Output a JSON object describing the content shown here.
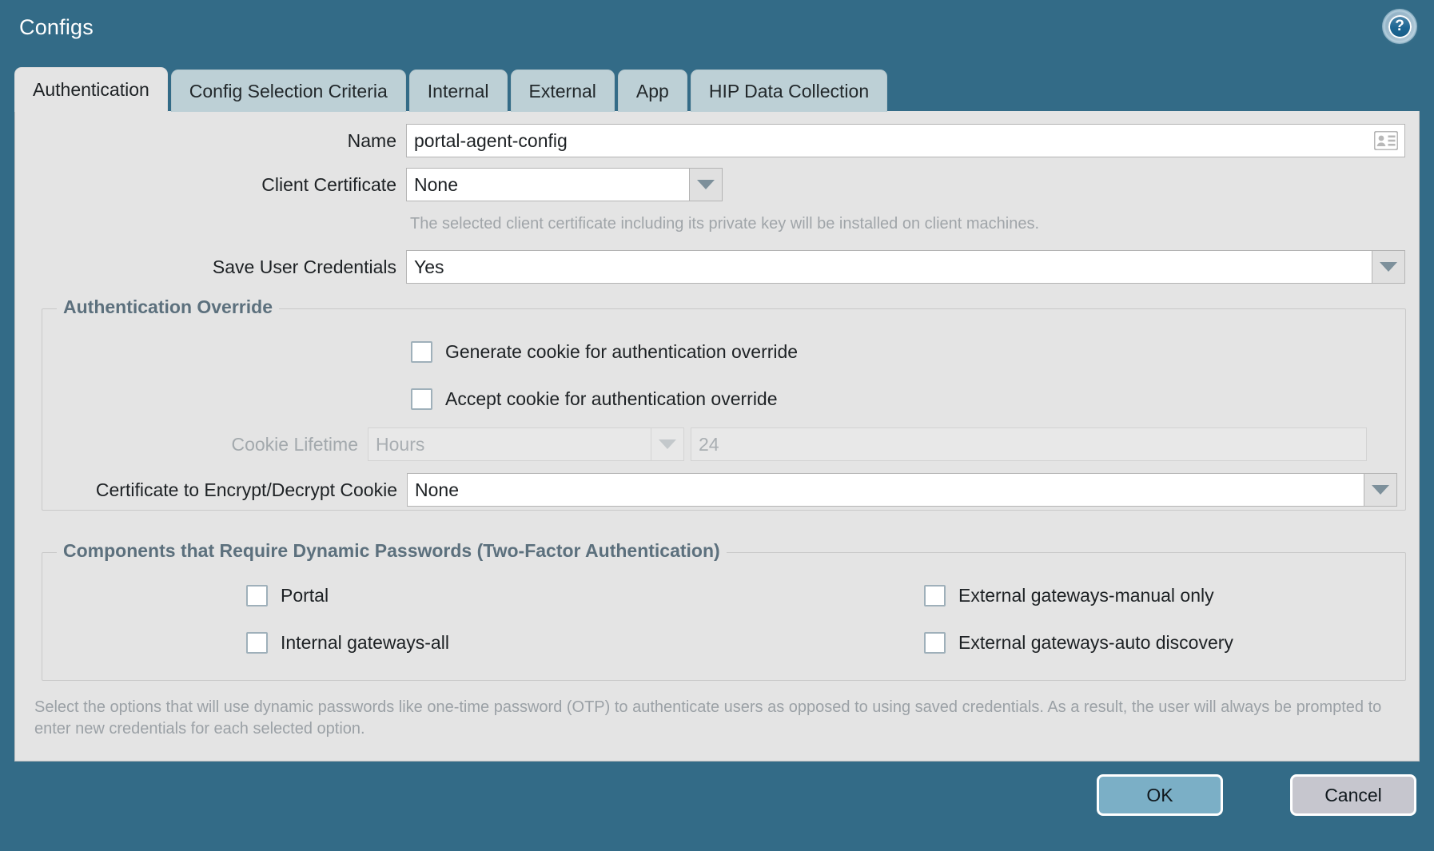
{
  "window": {
    "title": "Configs",
    "help_icon": "help-question-icon",
    "accent_color": "#336b87",
    "panel_bg": "#e4e4e4"
  },
  "tabs": [
    {
      "label": "Authentication",
      "active": true
    },
    {
      "label": "Config Selection Criteria",
      "active": false
    },
    {
      "label": "Internal",
      "active": false
    },
    {
      "label": "External",
      "active": false
    },
    {
      "label": "App",
      "active": false
    },
    {
      "label": "HIP Data Collection",
      "active": false
    }
  ],
  "form": {
    "name": {
      "label": "Name",
      "value": "portal-agent-config",
      "icon": "id-card-icon"
    },
    "client_certificate": {
      "label": "Client Certificate",
      "value": "None",
      "hint": "The selected client certificate including its private key will be installed on client machines."
    },
    "save_user_credentials": {
      "label": "Save User Credentials",
      "value": "Yes"
    }
  },
  "auth_override": {
    "legend": "Authentication Override",
    "generate_cookie": {
      "label": "Generate cookie for authentication override",
      "checked": false
    },
    "accept_cookie": {
      "label": "Accept cookie for authentication override",
      "checked": false
    },
    "cookie_lifetime": {
      "label": "Cookie Lifetime",
      "unit_value": "Hours",
      "amount_value": "24",
      "disabled": true
    },
    "certificate_cookie": {
      "label": "Certificate to Encrypt/Decrypt Cookie",
      "value": "None"
    }
  },
  "two_factor": {
    "legend": "Components that Require Dynamic Passwords (Two-Factor Authentication)",
    "options": [
      {
        "label": "Portal",
        "checked": false
      },
      {
        "label": "Internal gateways-all",
        "checked": false
      },
      {
        "label": "External gateways-manual only",
        "checked": false
      },
      {
        "label": "External gateways-auto discovery",
        "checked": false
      }
    ],
    "note": "Select the options that will use dynamic passwords like one-time password (OTP) to authenticate users as opposed to using saved credentials. As a result, the user will always be prompted to enter new credentials for each selected option."
  },
  "footer": {
    "ok_label": "OK",
    "cancel_label": "Cancel"
  }
}
